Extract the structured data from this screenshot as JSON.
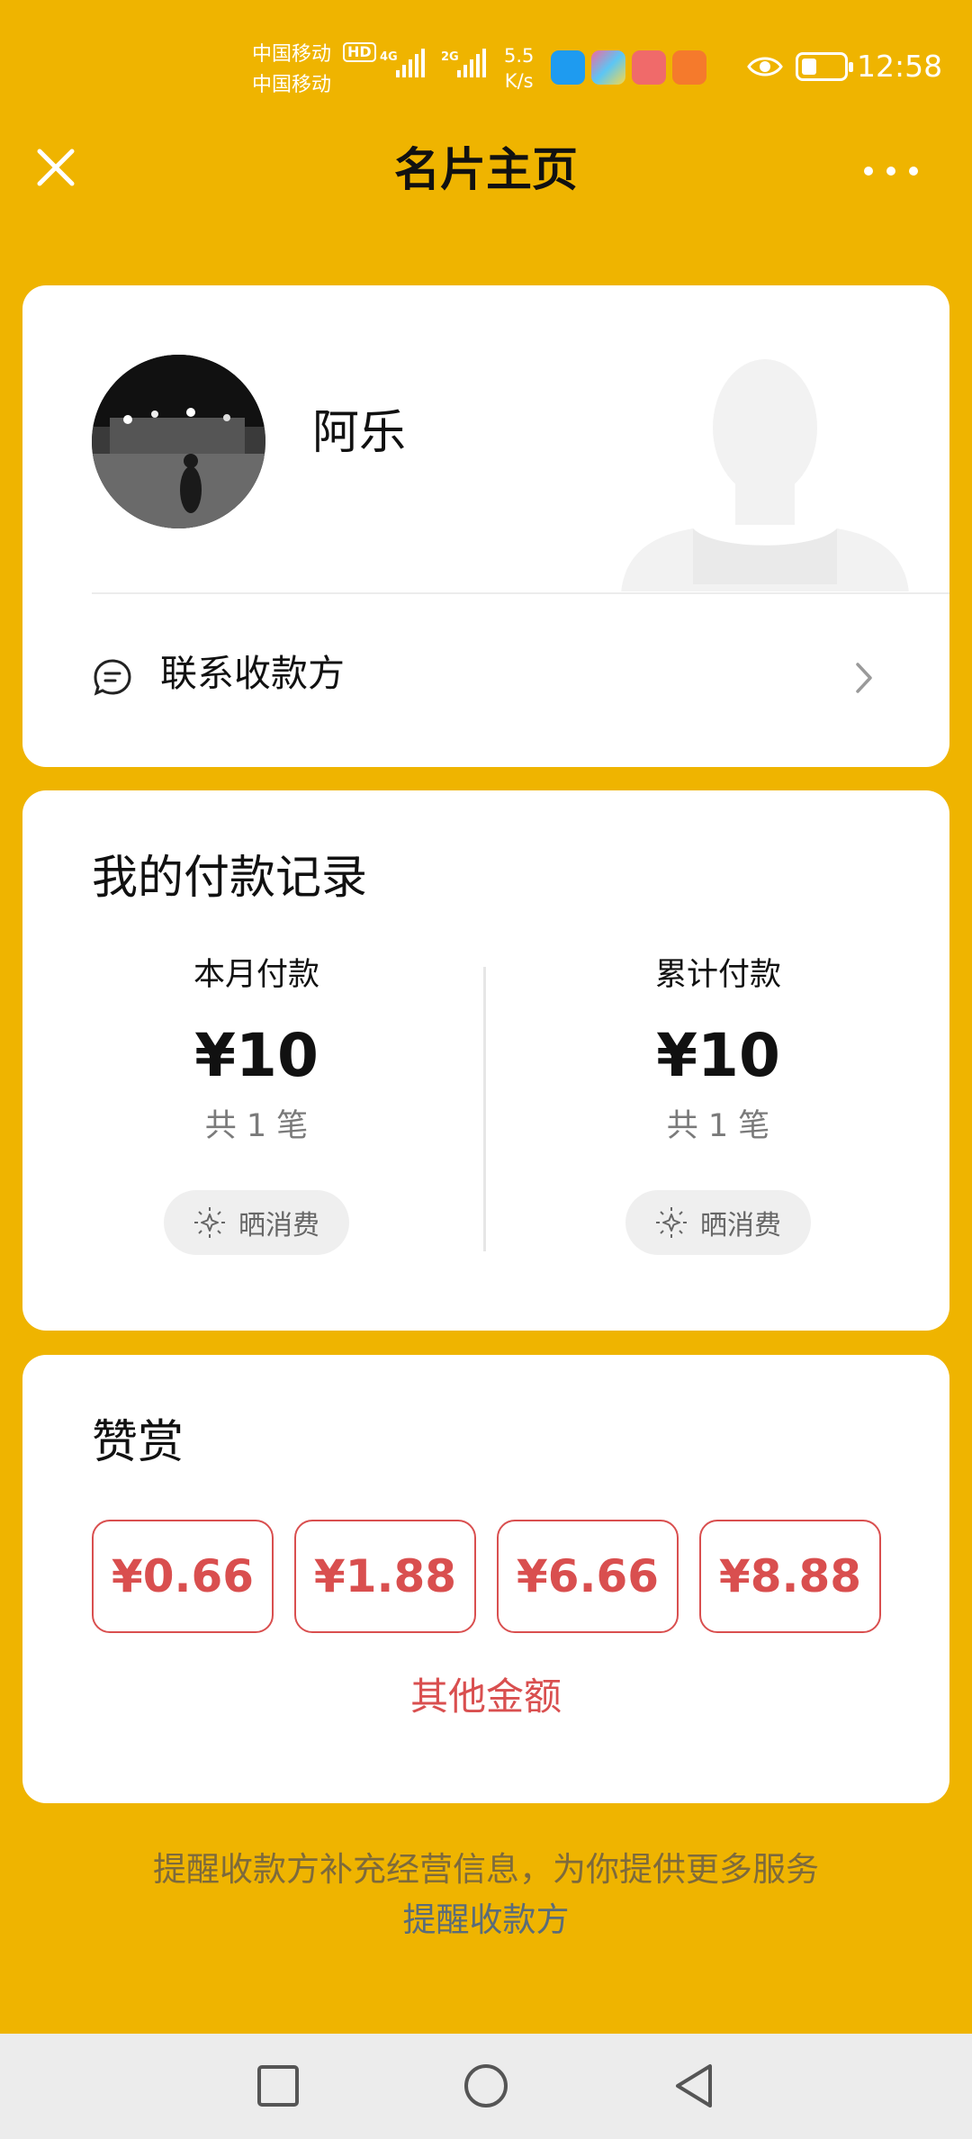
{
  "status_bar": {
    "carrier_1": "中国移动",
    "carrier_2": "中国移动",
    "hd": "HD",
    "net_1": "4G",
    "net_2": "2G",
    "speed_value": "5.5",
    "speed_unit": "K/s",
    "time": "12:58",
    "battery_level": 0.3,
    "icons": [
      "signal-icon",
      "app-store-icon",
      "paint-app-icon",
      "shopping-app-icon",
      "video-app-icon",
      "eye-icon",
      "battery-icon"
    ]
  },
  "header": {
    "title": "名片主页",
    "close_icon": "close-icon",
    "more_icon": "more-icon"
  },
  "profile": {
    "name": "阿乐",
    "contact_label": "联系收款方"
  },
  "records": {
    "title": "我的付款记录",
    "columns": [
      {
        "label": "本月付款",
        "amount": "¥10",
        "count": "共 1 笔",
        "share_label": "晒消费"
      },
      {
        "label": "累计付款",
        "amount": "¥10",
        "count": "共 1 笔",
        "share_label": "晒消费"
      }
    ]
  },
  "tip": {
    "title": "赞赏",
    "amounts": [
      "¥0.66",
      "¥1.88",
      "¥6.66",
      "¥8.88"
    ],
    "other_label": "其他金额"
  },
  "footer": {
    "tip_text": "提醒收款方补充经营信息，为你提供更多服务",
    "link_text": "提醒收款方"
  },
  "colors": {
    "background": "#efb400",
    "accent_red": "#d94f4f",
    "link": "#5a6c7a"
  }
}
